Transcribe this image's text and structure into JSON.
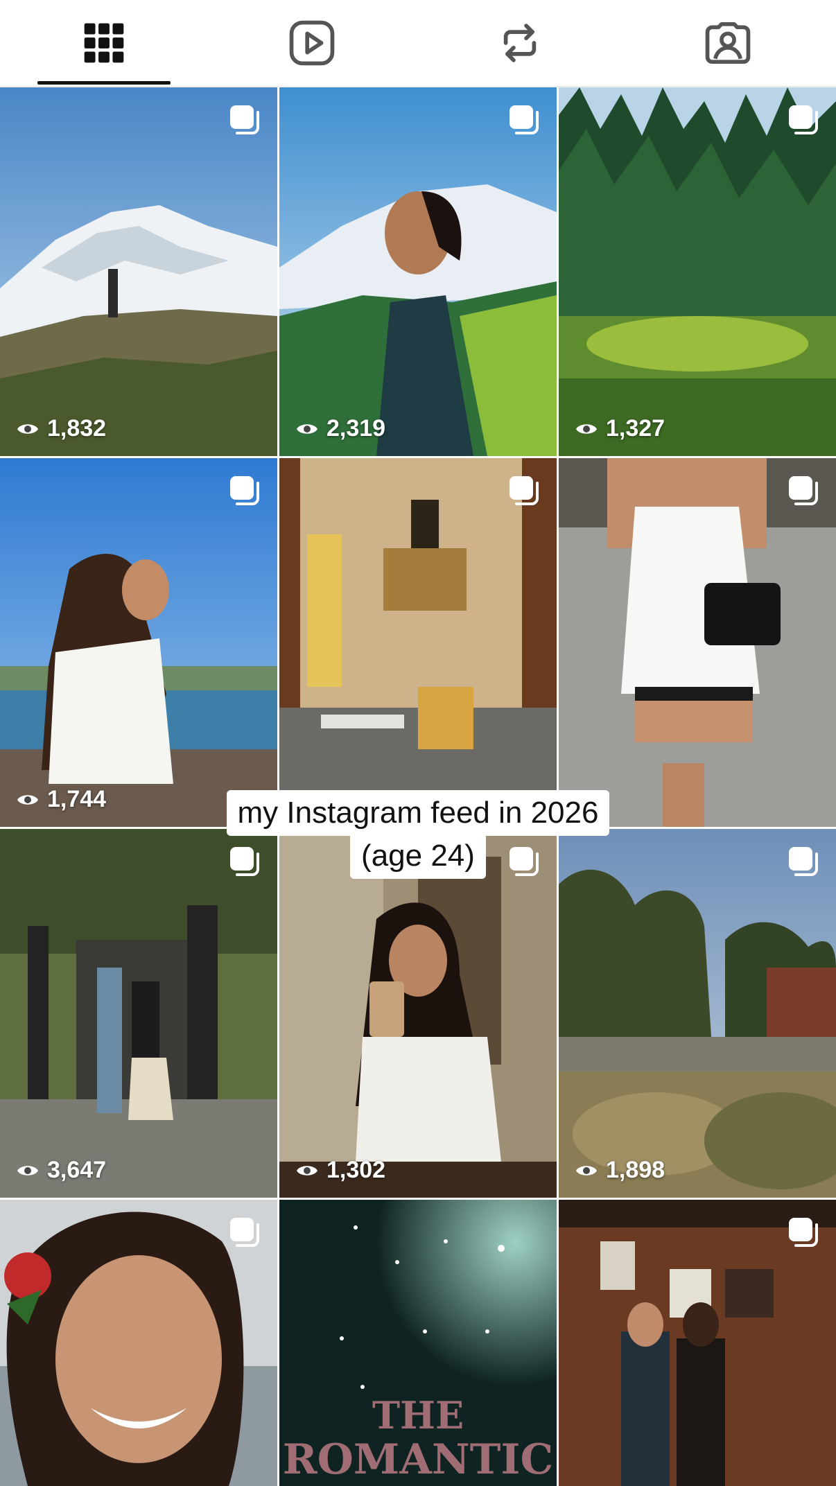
{
  "tabs": [
    {
      "name": "grid",
      "icon": "grid-icon",
      "selected": true
    },
    {
      "name": "reels",
      "icon": "reels-play-icon",
      "selected": false
    },
    {
      "name": "reposts",
      "icon": "repost-icon",
      "selected": false
    },
    {
      "name": "tagged",
      "icon": "tagged-person-icon",
      "selected": false
    }
  ],
  "posts": [
    {
      "views": "1,832",
      "scene": "mountain-hiker"
    },
    {
      "views": "2,319",
      "scene": "woman-mountain-profile"
    },
    {
      "views": "1,327",
      "scene": "forest-deer"
    },
    {
      "views": "1,744",
      "scene": "woman-lakeside"
    },
    {
      "views": "",
      "scene": "vintage-interior"
    },
    {
      "views": "",
      "scene": "white-top-street"
    },
    {
      "views": "3,647",
      "scene": "couple-dancing-gates"
    },
    {
      "views": "1,302",
      "scene": "woman-coffee"
    },
    {
      "views": "1,898",
      "scene": "garden-firepit"
    },
    {
      "views": "",
      "scene": "smiling-selfie"
    },
    {
      "views": "",
      "scene": "concert-romantic"
    },
    {
      "views": "",
      "scene": "couple-bar"
    }
  ],
  "caption": {
    "line1": "my Instagram feed in 2026",
    "line2": "(age 24)"
  },
  "colors": {
    "accent": "#111111",
    "background": "#ffffff",
    "icon": "#444444"
  }
}
